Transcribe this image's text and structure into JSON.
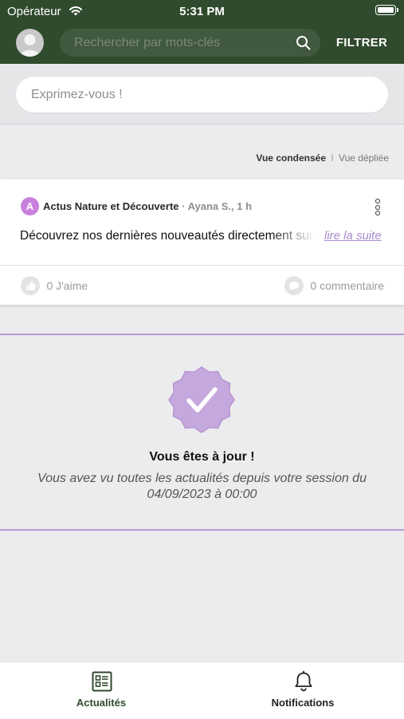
{
  "status_bar": {
    "carrier": "Opérateur",
    "time": "5:31 PM"
  },
  "header": {
    "search": {
      "placeholder": "Rechercher par mots-clés"
    },
    "filter_label": "FILTRER"
  },
  "composer": {
    "placeholder": "Exprimez-vous !"
  },
  "view_toggle": {
    "condensed": "Vue condensée",
    "separator": "I",
    "expanded": "Vue dépliée"
  },
  "post": {
    "avatar_letter": "A",
    "avatar_color": "#c880dd",
    "source": "Actus Nature et Découverte",
    "author_time": "· Ayana S., 1 h",
    "text": "Découvrez nos dernières nouveautés directement sur",
    "read_more": "lire la suite",
    "likes": "0 J'aime",
    "comments": "0 commentaire"
  },
  "up_to_date": {
    "title": "Vous êtes à jour !",
    "description": "Vous avez vu toutes les actualités depuis votre session du 04/09/2023 à 00:00"
  },
  "bottom_nav": {
    "items": [
      {
        "label": "Actualités",
        "icon": "news-icon",
        "active": true
      },
      {
        "label": "Notifications",
        "icon": "bell-icon",
        "active": false
      }
    ]
  },
  "colors": {
    "header_bg": "#2f4a2c",
    "accent_purple": "#b69ad3",
    "active_nav": "#2f4a2c"
  }
}
